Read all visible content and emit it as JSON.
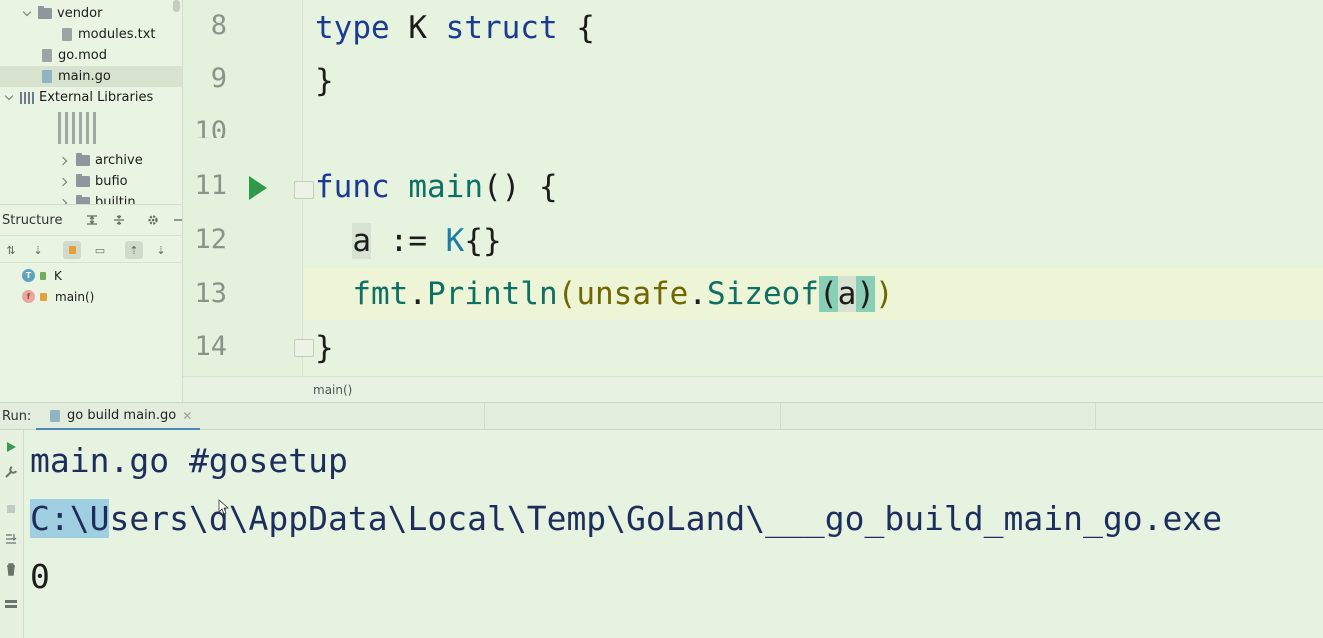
{
  "project_tree": {
    "items": [
      {
        "label": "vendor",
        "kind": "folder",
        "expanded": true
      },
      {
        "label": "modules.txt",
        "kind": "file"
      },
      {
        "label": "go.mod",
        "kind": "file"
      },
      {
        "label": "main.go",
        "kind": "go-file",
        "selected": true
      },
      {
        "label": "External Libraries",
        "kind": "library",
        "expanded": true
      },
      {
        "label": "archive",
        "kind": "folder"
      },
      {
        "label": "bufio",
        "kind": "folder"
      },
      {
        "label": "builtin",
        "kind": "folder"
      }
    ]
  },
  "structure": {
    "title": "Structure",
    "items": [
      {
        "badge": "T",
        "label": "K"
      },
      {
        "badge": "f",
        "label": "main()"
      }
    ]
  },
  "editor": {
    "line_numbers": [
      "8",
      "9",
      "10",
      "11",
      "12",
      "13",
      "14"
    ],
    "code": {
      "l8_kw1": "type",
      "l8_name": " K ",
      "l8_kw2": "struct",
      "l8_brace": " {",
      "l9": "}",
      "l11_kw": "func",
      "l11_name": "main",
      "l11_rest": "() {",
      "l12_var": "a",
      "l12_op": " := ",
      "l12_type": "K",
      "l12_rest": "{}",
      "l13_pkg": "fmt",
      "l13_dot": ".",
      "l13_fn": "Println",
      "l13_p1": "(",
      "l13_pkg2": "unsafe",
      "l13_dot2": ".",
      "l13_fn2": "Sizeof",
      "l13_p2": "(",
      "l13_arg": "a",
      "l13_p3": ")",
      "l13_p4": ")",
      "l14": "}"
    },
    "breadcrumb": "main()"
  },
  "run": {
    "label": "Run:",
    "tab": "go build main.go",
    "output": {
      "line1": "main.go #gosetup",
      "line2_selected": "C:\\U",
      "line2_rest": "sers\\d\\AppData\\Local\\Temp\\GoLand\\___go_build_main_go.exe",
      "line3": "0"
    }
  },
  "colors": {
    "background": "#e7f3e3",
    "keyword": "#1c3a90",
    "function": "#0e6f64",
    "run_green": "#2f9a4a",
    "selection": "#9fcfe0",
    "tab_underline": "#4d86b8"
  }
}
